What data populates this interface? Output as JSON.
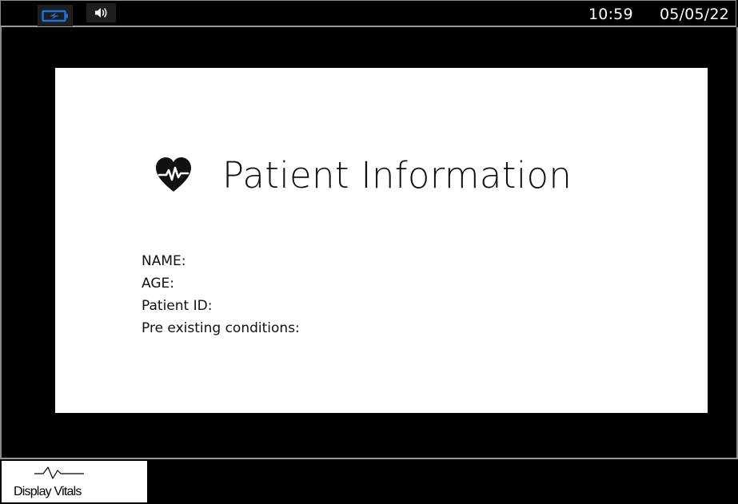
{
  "status_bar": {
    "battery_icon": "battery-charging-icon",
    "speaker_icon": "speaker-volume-icon",
    "time": "10:59",
    "date": "05/05/22"
  },
  "panel": {
    "title": "Patient Information",
    "title_icon": "heart-pulse-icon",
    "fields": {
      "name_label": "NAME:",
      "age_label": "AGE:",
      "patient_id_label": "Patient ID:",
      "conditions_label": "Pre existing conditions:"
    }
  },
  "nav": {
    "vitals_button_label": "Display Vitals",
    "vitals_icon": "vitals-waveform-icon"
  },
  "colors": {
    "background": "#000000",
    "panel": "#ffffff",
    "battery_accent": "#1a73d9",
    "border": "#8a8a8a"
  }
}
